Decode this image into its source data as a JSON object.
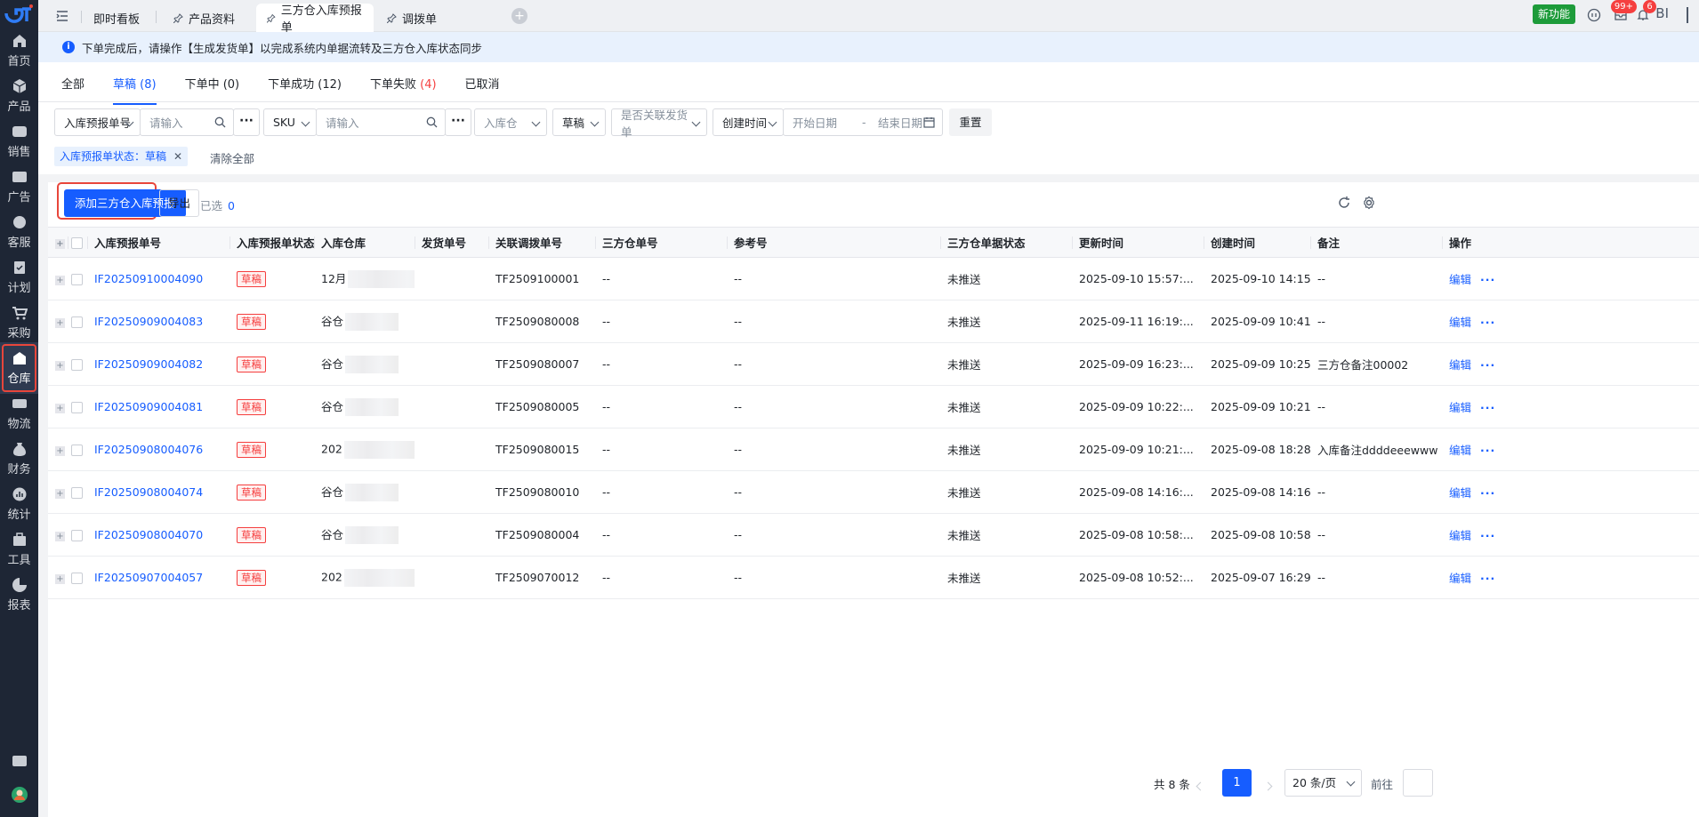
{
  "sidebar": {
    "items": [
      {
        "label": "首页",
        "icon": "home-icon"
      },
      {
        "label": "产品",
        "icon": "product-box-icon"
      },
      {
        "label": "销售",
        "icon": "sales-icon"
      },
      {
        "label": "广告",
        "icon": "ad-icon"
      },
      {
        "label": "客服",
        "icon": "customer-service-icon"
      },
      {
        "label": "计划",
        "icon": "plan-icon"
      },
      {
        "label": "采购",
        "icon": "cart-icon"
      },
      {
        "label": "仓库",
        "icon": "warehouse-icon"
      },
      {
        "label": "物流",
        "icon": "logistics-icon"
      },
      {
        "label": "财务",
        "icon": "finance-icon"
      },
      {
        "label": "统计",
        "icon": "stats-icon"
      },
      {
        "label": "工具",
        "icon": "tools-icon"
      },
      {
        "label": "报表",
        "icon": "report-icon"
      }
    ],
    "active_index": 7
  },
  "topbar": {
    "tabs": [
      {
        "label": "即时看板"
      },
      {
        "label": "产品资料"
      },
      {
        "label": "三方仓入库预报单"
      },
      {
        "label": "调拨单"
      }
    ],
    "active_tab": 2,
    "new_feature": "新功能",
    "badge_messages": "99+",
    "badge_notifications": "6",
    "bi_label": "BI"
  },
  "notice": {
    "text": "下单完成后，请操作【生成发货单】以完成系统内单据流转及三方仓入库状态同步"
  },
  "status_tabs": {
    "all": "全部",
    "draft": "草稿 (8)",
    "ordering": "下单中 (0)",
    "success": "下单成功 (12)",
    "failed_label": "下单失败",
    "failed_count": "(4)",
    "cancelled": "已取消"
  },
  "filters": {
    "order_no_select": "入库预报单号",
    "order_no_placeholder": "请输入",
    "sku_select": "SKU",
    "sku_placeholder": "请输入",
    "warehouse_placeholder": "入库仓",
    "status_value": "草稿",
    "linked_placeholder": "是否关联发货单",
    "time_select": "创建时间",
    "start_date": "开始日期",
    "date_sep": "-",
    "end_date": "结束日期",
    "reset": "重置",
    "active_tag": "入库预报单状态：草稿",
    "clear_all": "清除全部"
  },
  "toolbar": {
    "add_button": "添加三方仓入库预报",
    "export_button": "导出",
    "selected_label": "已选",
    "selected_count": "0"
  },
  "table": {
    "columns": [
      "入库预报单号",
      "入库预报单状态",
      "入库仓库",
      "发货单号",
      "关联调拨单号",
      "三方仓单号",
      "参考号",
      "三方仓单据状态",
      "更新时间",
      "创建时间",
      "备注",
      "操作"
    ],
    "rows": [
      {
        "order_no": "IF20250910004090",
        "status": "草稿",
        "warehouse": "12月",
        "ship_no": "",
        "transfer_no": "TF2509100001",
        "tp_no": "--",
        "ref_no": "--",
        "tp_status": "未推送",
        "updated": "2025-09-10 15:57:...",
        "created": "2025-09-10 14:15:...",
        "remark": "--"
      },
      {
        "order_no": "IF20250909004083",
        "status": "草稿",
        "warehouse": "谷仓",
        "ship_no": "",
        "transfer_no": "TF2509080008",
        "tp_no": "--",
        "ref_no": "--",
        "tp_status": "未推送",
        "updated": "2025-09-11 16:19:...",
        "created": "2025-09-09 10:41:...",
        "remark": "--"
      },
      {
        "order_no": "IF20250909004082",
        "status": "草稿",
        "warehouse": "谷仓",
        "ship_no": "",
        "transfer_no": "TF2509080007",
        "tp_no": "--",
        "ref_no": "--",
        "tp_status": "未推送",
        "updated": "2025-09-09 16:23:...",
        "created": "2025-09-09 10:25:...",
        "remark": "三方仓备注00002"
      },
      {
        "order_no": "IF20250909004081",
        "status": "草稿",
        "warehouse": "谷仓",
        "ship_no": "",
        "transfer_no": "TF2509080005",
        "tp_no": "--",
        "ref_no": "--",
        "tp_status": "未推送",
        "updated": "2025-09-09 10:22:...",
        "created": "2025-09-09 10:21:...",
        "remark": "--"
      },
      {
        "order_no": "IF20250908004076",
        "status": "草稿",
        "warehouse": "202",
        "ship_no": "",
        "transfer_no": "TF2509080015",
        "tp_no": "--",
        "ref_no": "--",
        "tp_status": "未推送",
        "updated": "2025-09-09 10:21:...",
        "created": "2025-09-08 18:28:...",
        "remark": "入库备注ddddeeewww"
      },
      {
        "order_no": "IF20250908004074",
        "status": "草稿",
        "warehouse": "谷仓",
        "ship_no": "",
        "transfer_no": "TF2509080010",
        "tp_no": "--",
        "ref_no": "--",
        "tp_status": "未推送",
        "updated": "2025-09-08 14:16:...",
        "created": "2025-09-08 14:16:...",
        "remark": "--"
      },
      {
        "order_no": "IF20250908004070",
        "status": "草稿",
        "warehouse": "谷仓",
        "ship_no": "",
        "transfer_no": "TF2509080004",
        "tp_no": "--",
        "ref_no": "--",
        "tp_status": "未推送",
        "updated": "2025-09-08 10:58:...",
        "created": "2025-09-08 10:58:...",
        "remark": "--"
      },
      {
        "order_no": "IF20250907004057",
        "status": "草稿",
        "warehouse": "202",
        "ship_no": "",
        "transfer_no": "TF2509070012",
        "tp_no": "--",
        "ref_no": "--",
        "tp_status": "未推送",
        "updated": "2025-09-08 10:52:...",
        "created": "2025-09-07 16:29:...",
        "remark": "--"
      }
    ],
    "edit_label": "编辑",
    "more_label": "···"
  },
  "pagination": {
    "total": "共 8 条",
    "current_page": "1",
    "page_size": "20 条/页",
    "goto_label": "前往"
  },
  "colors": {
    "primary": "#165dff",
    "danger": "#f53f3f",
    "sidebar_bg": "#1e2635",
    "new_feature": "#1d9b3a"
  }
}
